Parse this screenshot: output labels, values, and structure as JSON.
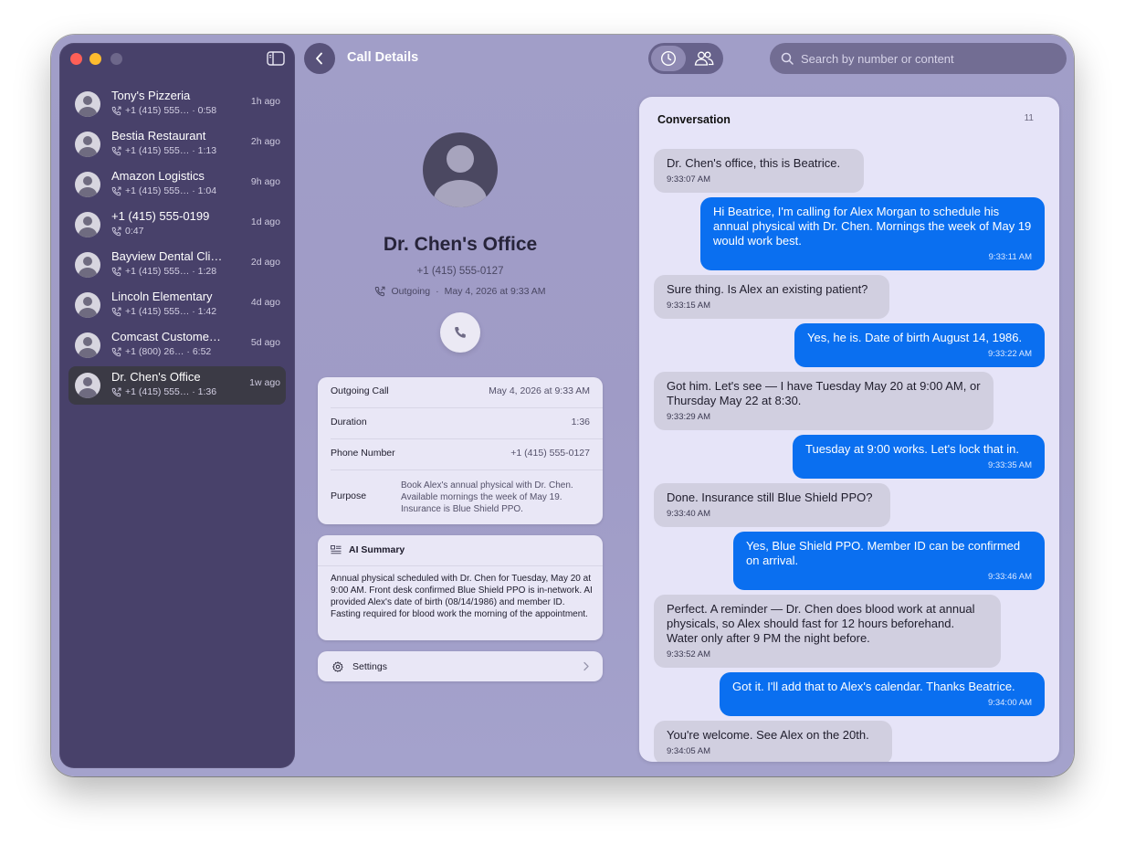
{
  "window": {
    "title": "Call Details",
    "search_placeholder": "Search by number or content"
  },
  "sidebar": {
    "calls": [
      {
        "name": "Tony's Pizzeria",
        "number": "+1 (415) 555…",
        "duration": "0:58",
        "time": "1h ago",
        "selected": false
      },
      {
        "name": "Bestia Restaurant",
        "number": "+1 (415) 555…",
        "duration": "1:13",
        "time": "2h ago",
        "selected": false
      },
      {
        "name": "Amazon Logistics",
        "number": "+1 (415) 555…",
        "duration": "1:04",
        "time": "9h ago",
        "selected": false
      },
      {
        "name": "+1 (415) 555-0199",
        "number": "",
        "duration": "0:47",
        "time": "1d ago",
        "selected": false
      },
      {
        "name": "Bayview Dental Cli…",
        "number": "+1 (415) 555…",
        "duration": "1:28",
        "time": "2d ago",
        "selected": false
      },
      {
        "name": "Lincoln Elementary",
        "number": "+1 (415) 555…",
        "duration": "1:42",
        "time": "4d ago",
        "selected": false
      },
      {
        "name": "Comcast Custome…",
        "number": "+1 (800) 26…",
        "duration": "6:52",
        "time": "5d ago",
        "selected": false
      },
      {
        "name": "Dr. Chen's Office",
        "number": "+1 (415) 555…",
        "duration": "1:36",
        "time": "1w ago",
        "selected": true
      }
    ]
  },
  "contact": {
    "name": "Dr. Chen's Office",
    "phone": "+1 (415) 555-0127",
    "direction": "Outgoing",
    "date": "May 4, 2026 at 9:33 AM"
  },
  "details": {
    "outgoing_label": "Outgoing Call",
    "outgoing_value": "May 4, 2026 at 9:33 AM",
    "duration_label": "Duration",
    "duration_value": "1:36",
    "phone_label": "Phone Number",
    "phone_value": "+1 (415) 555-0127",
    "purpose_label": "Purpose",
    "purpose_value": "Book Alex's annual physical with Dr. Chen. Available mornings the week of May 19. Insurance is Blue Shield PPO."
  },
  "summary": {
    "title": "AI Summary",
    "text": "Annual physical scheduled with Dr. Chen for Tuesday, May 20 at 9:00 AM. Front desk confirmed Blue Shield PPO is in-network. AI provided Alex's date of birth (08/14/1986) and member ID. Fasting required for blood work the morning of the appointment."
  },
  "settings": {
    "label": "Settings"
  },
  "conversation": {
    "title": "Conversation",
    "count": "11",
    "messages": [
      {
        "dir": "in",
        "text": "Dr. Chen's office, this is Beatrice.",
        "time": "9:33:07 AM"
      },
      {
        "dir": "out",
        "text": "Hi Beatrice, I'm calling for Alex Morgan to schedule his annual physical with Dr. Chen. Mornings the week of May 19 would work best.",
        "time": "9:33:11 AM"
      },
      {
        "dir": "in",
        "text": "Sure thing. Is Alex an existing patient?",
        "time": "9:33:15 AM"
      },
      {
        "dir": "out",
        "text": "Yes, he is. Date of birth August 14, 1986.",
        "time": "9:33:22 AM"
      },
      {
        "dir": "in",
        "text": "Got him. Let's see — I have Tuesday May 20 at 9:00 AM, or Thursday May 22 at 8:30.",
        "time": "9:33:29 AM"
      },
      {
        "dir": "out",
        "text": "Tuesday at 9:00 works. Let's lock that in.",
        "time": "9:33:35 AM"
      },
      {
        "dir": "in",
        "text": "Done. Insurance still Blue Shield PPO?",
        "time": "9:33:40 AM"
      },
      {
        "dir": "out",
        "text": "Yes, Blue Shield PPO. Member ID can be confirmed on arrival.",
        "time": "9:33:46 AM"
      },
      {
        "dir": "in",
        "text": "Perfect. A reminder — Dr. Chen does blood work at annual physicals, so Alex should fast for 12 hours beforehand. Water only after 9 PM the night before.",
        "time": "9:33:52 AM"
      },
      {
        "dir": "out",
        "text": "Got it. I'll add that to Alex's calendar. Thanks Beatrice.",
        "time": "9:34:00 AM"
      },
      {
        "dir": "in",
        "text": "You're welcome. See Alex on the 20th.",
        "time": "9:34:05 AM"
      }
    ]
  },
  "icons": {
    "back": "chevron-left-icon",
    "history": "clock-icon",
    "contacts": "people-icon",
    "search": "search-icon",
    "call": "phone-icon",
    "summary": "list-icon",
    "settings": "gear-icon"
  },
  "colors": {
    "accent": "#0a6ff0",
    "sidebar": "#48416a",
    "selected_row": "#3b3a45",
    "close": "#fe5f57",
    "minimize": "#febc2e"
  }
}
